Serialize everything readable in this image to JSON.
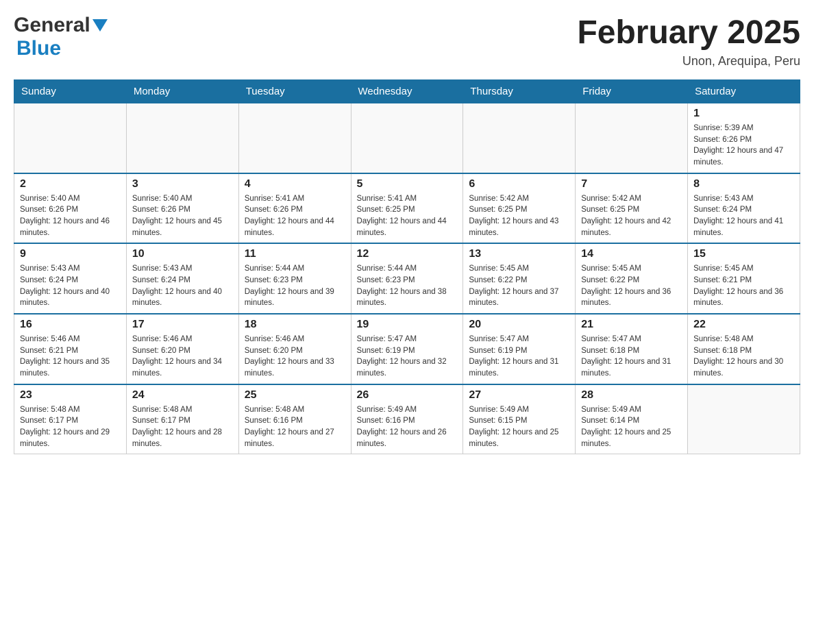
{
  "header": {
    "logo_general": "General",
    "logo_blue": "Blue",
    "month_title": "February 2025",
    "location": "Unon, Arequipa, Peru"
  },
  "weekdays": [
    "Sunday",
    "Monday",
    "Tuesday",
    "Wednesday",
    "Thursday",
    "Friday",
    "Saturday"
  ],
  "weeks": [
    [
      {
        "day": "",
        "info": ""
      },
      {
        "day": "",
        "info": ""
      },
      {
        "day": "",
        "info": ""
      },
      {
        "day": "",
        "info": ""
      },
      {
        "day": "",
        "info": ""
      },
      {
        "day": "",
        "info": ""
      },
      {
        "day": "1",
        "info": "Sunrise: 5:39 AM\nSunset: 6:26 PM\nDaylight: 12 hours and 47 minutes."
      }
    ],
    [
      {
        "day": "2",
        "info": "Sunrise: 5:40 AM\nSunset: 6:26 PM\nDaylight: 12 hours and 46 minutes."
      },
      {
        "day": "3",
        "info": "Sunrise: 5:40 AM\nSunset: 6:26 PM\nDaylight: 12 hours and 45 minutes."
      },
      {
        "day": "4",
        "info": "Sunrise: 5:41 AM\nSunset: 6:26 PM\nDaylight: 12 hours and 44 minutes."
      },
      {
        "day": "5",
        "info": "Sunrise: 5:41 AM\nSunset: 6:25 PM\nDaylight: 12 hours and 44 minutes."
      },
      {
        "day": "6",
        "info": "Sunrise: 5:42 AM\nSunset: 6:25 PM\nDaylight: 12 hours and 43 minutes."
      },
      {
        "day": "7",
        "info": "Sunrise: 5:42 AM\nSunset: 6:25 PM\nDaylight: 12 hours and 42 minutes."
      },
      {
        "day": "8",
        "info": "Sunrise: 5:43 AM\nSunset: 6:24 PM\nDaylight: 12 hours and 41 minutes."
      }
    ],
    [
      {
        "day": "9",
        "info": "Sunrise: 5:43 AM\nSunset: 6:24 PM\nDaylight: 12 hours and 40 minutes."
      },
      {
        "day": "10",
        "info": "Sunrise: 5:43 AM\nSunset: 6:24 PM\nDaylight: 12 hours and 40 minutes."
      },
      {
        "day": "11",
        "info": "Sunrise: 5:44 AM\nSunset: 6:23 PM\nDaylight: 12 hours and 39 minutes."
      },
      {
        "day": "12",
        "info": "Sunrise: 5:44 AM\nSunset: 6:23 PM\nDaylight: 12 hours and 38 minutes."
      },
      {
        "day": "13",
        "info": "Sunrise: 5:45 AM\nSunset: 6:22 PM\nDaylight: 12 hours and 37 minutes."
      },
      {
        "day": "14",
        "info": "Sunrise: 5:45 AM\nSunset: 6:22 PM\nDaylight: 12 hours and 36 minutes."
      },
      {
        "day": "15",
        "info": "Sunrise: 5:45 AM\nSunset: 6:21 PM\nDaylight: 12 hours and 36 minutes."
      }
    ],
    [
      {
        "day": "16",
        "info": "Sunrise: 5:46 AM\nSunset: 6:21 PM\nDaylight: 12 hours and 35 minutes."
      },
      {
        "day": "17",
        "info": "Sunrise: 5:46 AM\nSunset: 6:20 PM\nDaylight: 12 hours and 34 minutes."
      },
      {
        "day": "18",
        "info": "Sunrise: 5:46 AM\nSunset: 6:20 PM\nDaylight: 12 hours and 33 minutes."
      },
      {
        "day": "19",
        "info": "Sunrise: 5:47 AM\nSunset: 6:19 PM\nDaylight: 12 hours and 32 minutes."
      },
      {
        "day": "20",
        "info": "Sunrise: 5:47 AM\nSunset: 6:19 PM\nDaylight: 12 hours and 31 minutes."
      },
      {
        "day": "21",
        "info": "Sunrise: 5:47 AM\nSunset: 6:18 PM\nDaylight: 12 hours and 31 minutes."
      },
      {
        "day": "22",
        "info": "Sunrise: 5:48 AM\nSunset: 6:18 PM\nDaylight: 12 hours and 30 minutes."
      }
    ],
    [
      {
        "day": "23",
        "info": "Sunrise: 5:48 AM\nSunset: 6:17 PM\nDaylight: 12 hours and 29 minutes."
      },
      {
        "day": "24",
        "info": "Sunrise: 5:48 AM\nSunset: 6:17 PM\nDaylight: 12 hours and 28 minutes."
      },
      {
        "day": "25",
        "info": "Sunrise: 5:48 AM\nSunset: 6:16 PM\nDaylight: 12 hours and 27 minutes."
      },
      {
        "day": "26",
        "info": "Sunrise: 5:49 AM\nSunset: 6:16 PM\nDaylight: 12 hours and 26 minutes."
      },
      {
        "day": "27",
        "info": "Sunrise: 5:49 AM\nSunset: 6:15 PM\nDaylight: 12 hours and 25 minutes."
      },
      {
        "day": "28",
        "info": "Sunrise: 5:49 AM\nSunset: 6:14 PM\nDaylight: 12 hours and 25 minutes."
      },
      {
        "day": "",
        "info": ""
      }
    ]
  ]
}
